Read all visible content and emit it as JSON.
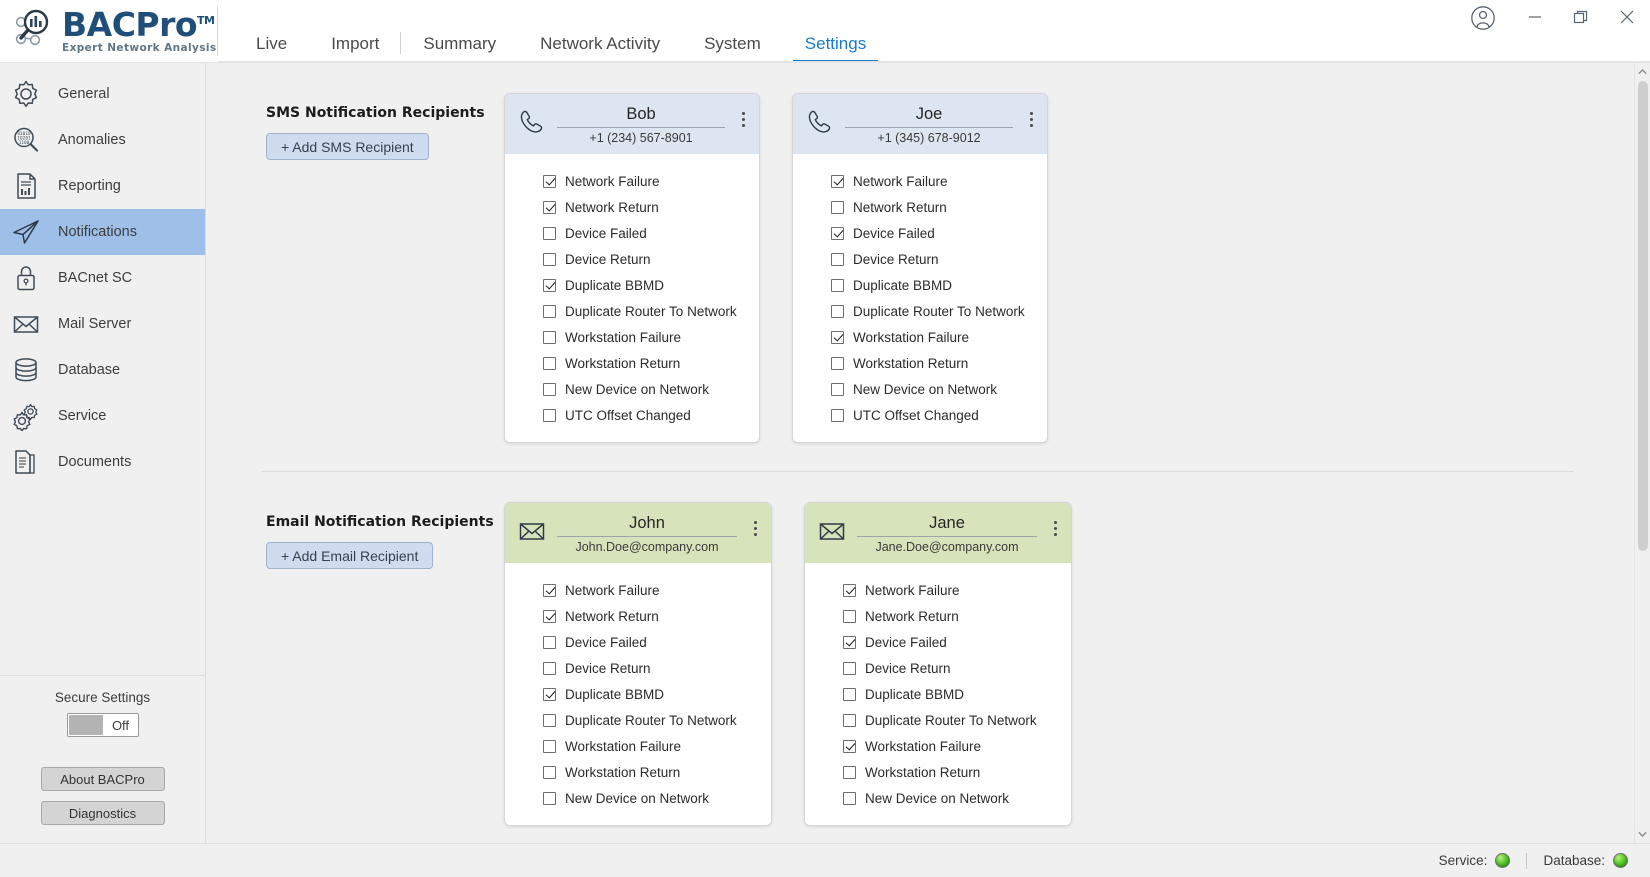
{
  "app": {
    "brand_name": "BACPro",
    "brand_tm": "TM",
    "brand_tagline": "Expert Network Analysis",
    "accent_color": "#1979ca",
    "sms_header_color": "#dde5f1",
    "email_header_color": "#d7e4bb",
    "sidebar_active_color": "#9dbfe8"
  },
  "titlebar": {
    "account_icon": "account-icon",
    "minimize_label": "—",
    "restore_label": "❐",
    "close_label": "✕"
  },
  "tabs": [
    {
      "label": "Live",
      "active": false
    },
    {
      "label": "Import",
      "active": false
    },
    {
      "label": "Summary",
      "active": false
    },
    {
      "label": "Network Activity",
      "active": false
    },
    {
      "label": "System",
      "active": false
    },
    {
      "label": "Settings",
      "active": true
    }
  ],
  "sidebar": {
    "items": [
      {
        "label": "General",
        "icon": "gear-icon",
        "active": false
      },
      {
        "label": "Anomalies",
        "icon": "magnifier-binary-icon",
        "active": false
      },
      {
        "label": "Reporting",
        "icon": "report-document-icon",
        "active": false
      },
      {
        "label": "Notifications",
        "icon": "paper-plane-icon",
        "active": true
      },
      {
        "label": "BACnet SC",
        "icon": "lock-icon",
        "active": false
      },
      {
        "label": "Mail Server",
        "icon": "envelope-icon",
        "active": false
      },
      {
        "label": "Database",
        "icon": "database-icon",
        "active": false
      },
      {
        "label": "Service",
        "icon": "gears-icon",
        "active": false
      },
      {
        "label": "Documents",
        "icon": "documents-icon",
        "active": false
      }
    ],
    "secure_settings_label": "Secure Settings",
    "secure_settings_state": "Off",
    "about_button": "About BACPro",
    "diagnostics_button": "Diagnostics"
  },
  "sections": [
    {
      "id": "sms",
      "title": "SMS Notification Recipients",
      "add_button": "+ Add SMS Recipient",
      "head_style": "sms",
      "icon": "phone-icon",
      "cards": [
        {
          "name": "Bob",
          "contact": "+1 (234) 567-8901",
          "options": [
            {
              "label": "Network Failure",
              "checked": true
            },
            {
              "label": "Network Return",
              "checked": true
            },
            {
              "label": "Device Failed",
              "checked": false
            },
            {
              "label": "Device Return",
              "checked": false
            },
            {
              "label": "Duplicate BBMD",
              "checked": true
            },
            {
              "label": "Duplicate Router To Network",
              "checked": false
            },
            {
              "label": "Workstation Failure",
              "checked": false
            },
            {
              "label": "Workstation Return",
              "checked": false
            },
            {
              "label": "New Device on Network",
              "checked": false
            },
            {
              "label": "UTC Offset Changed",
              "checked": false
            }
          ]
        },
        {
          "name": "Joe",
          "contact": "+1 (345) 678-9012",
          "options": [
            {
              "label": "Network Failure",
              "checked": true
            },
            {
              "label": "Network Return",
              "checked": false
            },
            {
              "label": "Device Failed",
              "checked": true
            },
            {
              "label": "Device Return",
              "checked": false
            },
            {
              "label": "Duplicate BBMD",
              "checked": false
            },
            {
              "label": "Duplicate Router To Network",
              "checked": false
            },
            {
              "label": "Workstation Failure",
              "checked": true
            },
            {
              "label": "Workstation Return",
              "checked": false
            },
            {
              "label": "New Device on Network",
              "checked": false
            },
            {
              "label": "UTC Offset Changed",
              "checked": false
            }
          ]
        }
      ]
    },
    {
      "id": "email",
      "title": "Email Notification Recipients",
      "add_button": "+ Add Email Recipient",
      "head_style": "email",
      "icon": "envelope-icon",
      "cards": [
        {
          "name": "John",
          "contact": "John.Doe@company.com",
          "options": [
            {
              "label": "Network Failure",
              "checked": true
            },
            {
              "label": "Network Return",
              "checked": true
            },
            {
              "label": "Device Failed",
              "checked": false
            },
            {
              "label": "Device Return",
              "checked": false
            },
            {
              "label": "Duplicate BBMD",
              "checked": true
            },
            {
              "label": "Duplicate Router To Network",
              "checked": false
            },
            {
              "label": "Workstation Failure",
              "checked": false
            },
            {
              "label": "Workstation Return",
              "checked": false
            },
            {
              "label": "New Device on Network",
              "checked": false
            }
          ]
        },
        {
          "name": "Jane",
          "contact": "Jane.Doe@company.com",
          "options": [
            {
              "label": "Network Failure",
              "checked": true
            },
            {
              "label": "Network Return",
              "checked": false
            },
            {
              "label": "Device Failed",
              "checked": true
            },
            {
              "label": "Device Return",
              "checked": false
            },
            {
              "label": "Duplicate BBMD",
              "checked": false
            },
            {
              "label": "Duplicate Router To Network",
              "checked": false
            },
            {
              "label": "Workstation Failure",
              "checked": true
            },
            {
              "label": "Workstation Return",
              "checked": false
            },
            {
              "label": "New Device on Network",
              "checked": false
            }
          ]
        }
      ]
    }
  ],
  "statusbar": {
    "service_label": "Service:",
    "service_state_color": "#54c72b",
    "database_label": "Database:",
    "database_state_color": "#54c72b"
  }
}
